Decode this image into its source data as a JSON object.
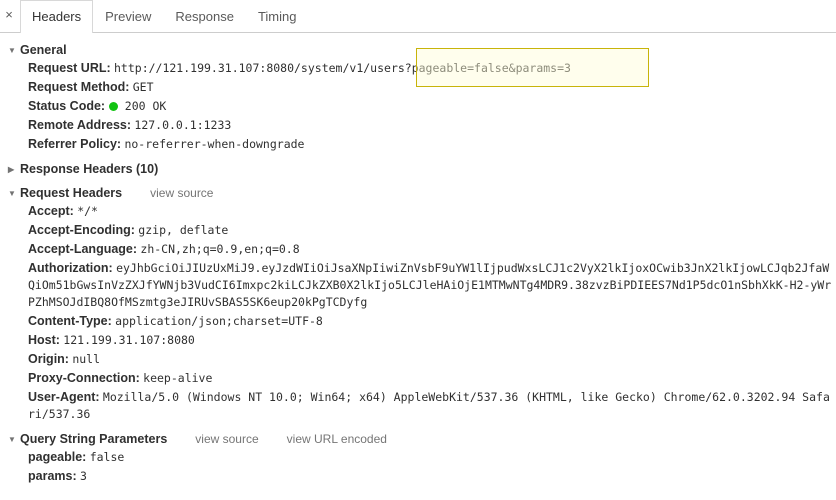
{
  "tabbar": {
    "close_label": "×",
    "tabs": [
      {
        "label": "Headers",
        "active": true
      },
      {
        "label": "Preview",
        "active": false
      },
      {
        "label": "Response",
        "active": false
      },
      {
        "label": "Timing",
        "active": false
      }
    ]
  },
  "sections": {
    "general": {
      "title": "General",
      "twisty": "▼",
      "rows": [
        {
          "key": "Request URL:",
          "value": "http://121.199.31.107:8080/system/v1/users?pageable=false&params=3"
        },
        {
          "key": "Request Method:",
          "value": "GET"
        },
        {
          "key": "Status Code:",
          "value": "200 OK",
          "has_dot": true
        },
        {
          "key": "Remote Address:",
          "value": "127.0.0.1:1233"
        },
        {
          "key": "Referrer Policy:",
          "value": "no-referrer-when-downgrade"
        }
      ]
    },
    "response_headers": {
      "title": "Response Headers (10)",
      "twisty": "▶",
      "count": 10
    },
    "request_headers": {
      "title": "Request Headers",
      "twisty": "▼",
      "view_source": "view source",
      "rows": [
        {
          "key": "Accept:",
          "value": "*/*"
        },
        {
          "key": "Accept-Encoding:",
          "value": "gzip, deflate"
        },
        {
          "key": "Accept-Language:",
          "value": "zh-CN,zh;q=0.9,en;q=0.8"
        },
        {
          "key": "Authorization:",
          "value": "eyJhbGciOiJIUzUxMiJ9.eyJzdWIiOiJsaXNpIiwiZnVsbF9uYW1lIjpudWxsLCJ1c2VyX2lkIjoxOCwib3JnX2lkIjowLCJqb2JfaWQiOm51bGwsInVzZXJfYWNjb3VudCI6Imxpc2kiLCJkZXB0X2lkIjo5LCJleHAiOjE1MTMwNTg4MDR9.38zvzBiPDIEES7Nd1P5dcO1nSbhXkK-H2-yWrPZhMSOJdIBQ8OfMSzmtg3eJIRUvSBAS5SK6eup20kPgTCDyfg"
        },
        {
          "key": "Content-Type:",
          "value": "application/json;charset=UTF-8"
        },
        {
          "key": "Host:",
          "value": "121.199.31.107:8080"
        },
        {
          "key": "Origin:",
          "value": "null"
        },
        {
          "key": "Proxy-Connection:",
          "value": "keep-alive"
        },
        {
          "key": "User-Agent:",
          "value": "Mozilla/5.0 (Windows NT 10.0; Win64; x64) AppleWebKit/537.36 (KHTML, like Gecko) Chrome/62.0.3202.94 Safari/537.36"
        }
      ]
    },
    "query_string": {
      "title": "Query String Parameters",
      "twisty": "▼",
      "view_source": "view source",
      "view_url_encoded": "view URL encoded",
      "rows": [
        {
          "key": "pageable:",
          "value": "false"
        },
        {
          "key": "params:",
          "value": "3"
        }
      ]
    }
  },
  "highlight": {
    "text": "?pageable=false&params=3",
    "border_color": "#c8b40a"
  }
}
